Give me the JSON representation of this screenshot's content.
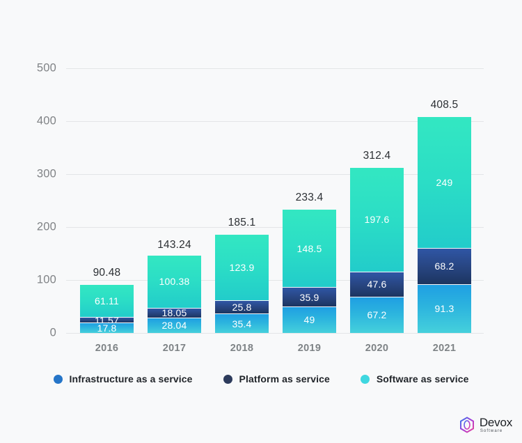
{
  "chart_data": {
    "type": "bar",
    "subtype": "stacked-bar",
    "title": "",
    "subtitle": "",
    "xlabel": "",
    "ylabel": "",
    "categories": [
      "2016",
      "2017",
      "2018",
      "2019",
      "2020",
      "2021"
    ],
    "series": [
      {
        "name": "Infrastructure as a service",
        "color": "#2196DD",
        "values": [
          17.8,
          28.04,
          35.4,
          49,
          67.2,
          91.3
        ],
        "labels": [
          "17.8",
          "28.04",
          "35.4",
          "49",
          "67.2",
          "91.3"
        ]
      },
      {
        "name": "Platform as service",
        "color": "#2A3A5E",
        "values": [
          11.57,
          18.05,
          25.8,
          35.9,
          47.6,
          68.2
        ],
        "labels": [
          "11.57",
          "18.05",
          "25.8",
          "35.9",
          "47.6",
          "68.2"
        ]
      },
      {
        "name": "Software as service",
        "color": "#3DD9D6",
        "values": [
          61.11,
          100.38,
          123.9,
          148.5,
          197.6,
          249
        ],
        "labels": [
          "61.11",
          "100.38",
          "123.9",
          "148.5",
          "197.6",
          "249"
        ]
      }
    ],
    "totals": [
      90.48,
      143.24,
      185.1,
      233.4,
      312.4,
      408.5
    ],
    "total_labels": [
      "90.48",
      "143.24",
      "185.1",
      "233.4",
      "312.4",
      "408.5"
    ],
    "ylim": [
      0,
      500
    ],
    "y_ticks": [
      0,
      100,
      200,
      300,
      400,
      500
    ],
    "y_tick_labels": [
      "0",
      "100",
      "200",
      "300",
      "400",
      "500"
    ],
    "grid": true,
    "legend_position": "bottom",
    "background_color": "#F8F9FA"
  },
  "legend": {
    "items": [
      {
        "label": "Infrastructure as a service",
        "color": "#2575C8"
      },
      {
        "label": "Platform as service",
        "color": "#2D3B5C"
      },
      {
        "label": "Software as service",
        "color": "#3FD7E0"
      }
    ]
  },
  "logo": {
    "name": "Devox",
    "subtitle": "Software"
  }
}
